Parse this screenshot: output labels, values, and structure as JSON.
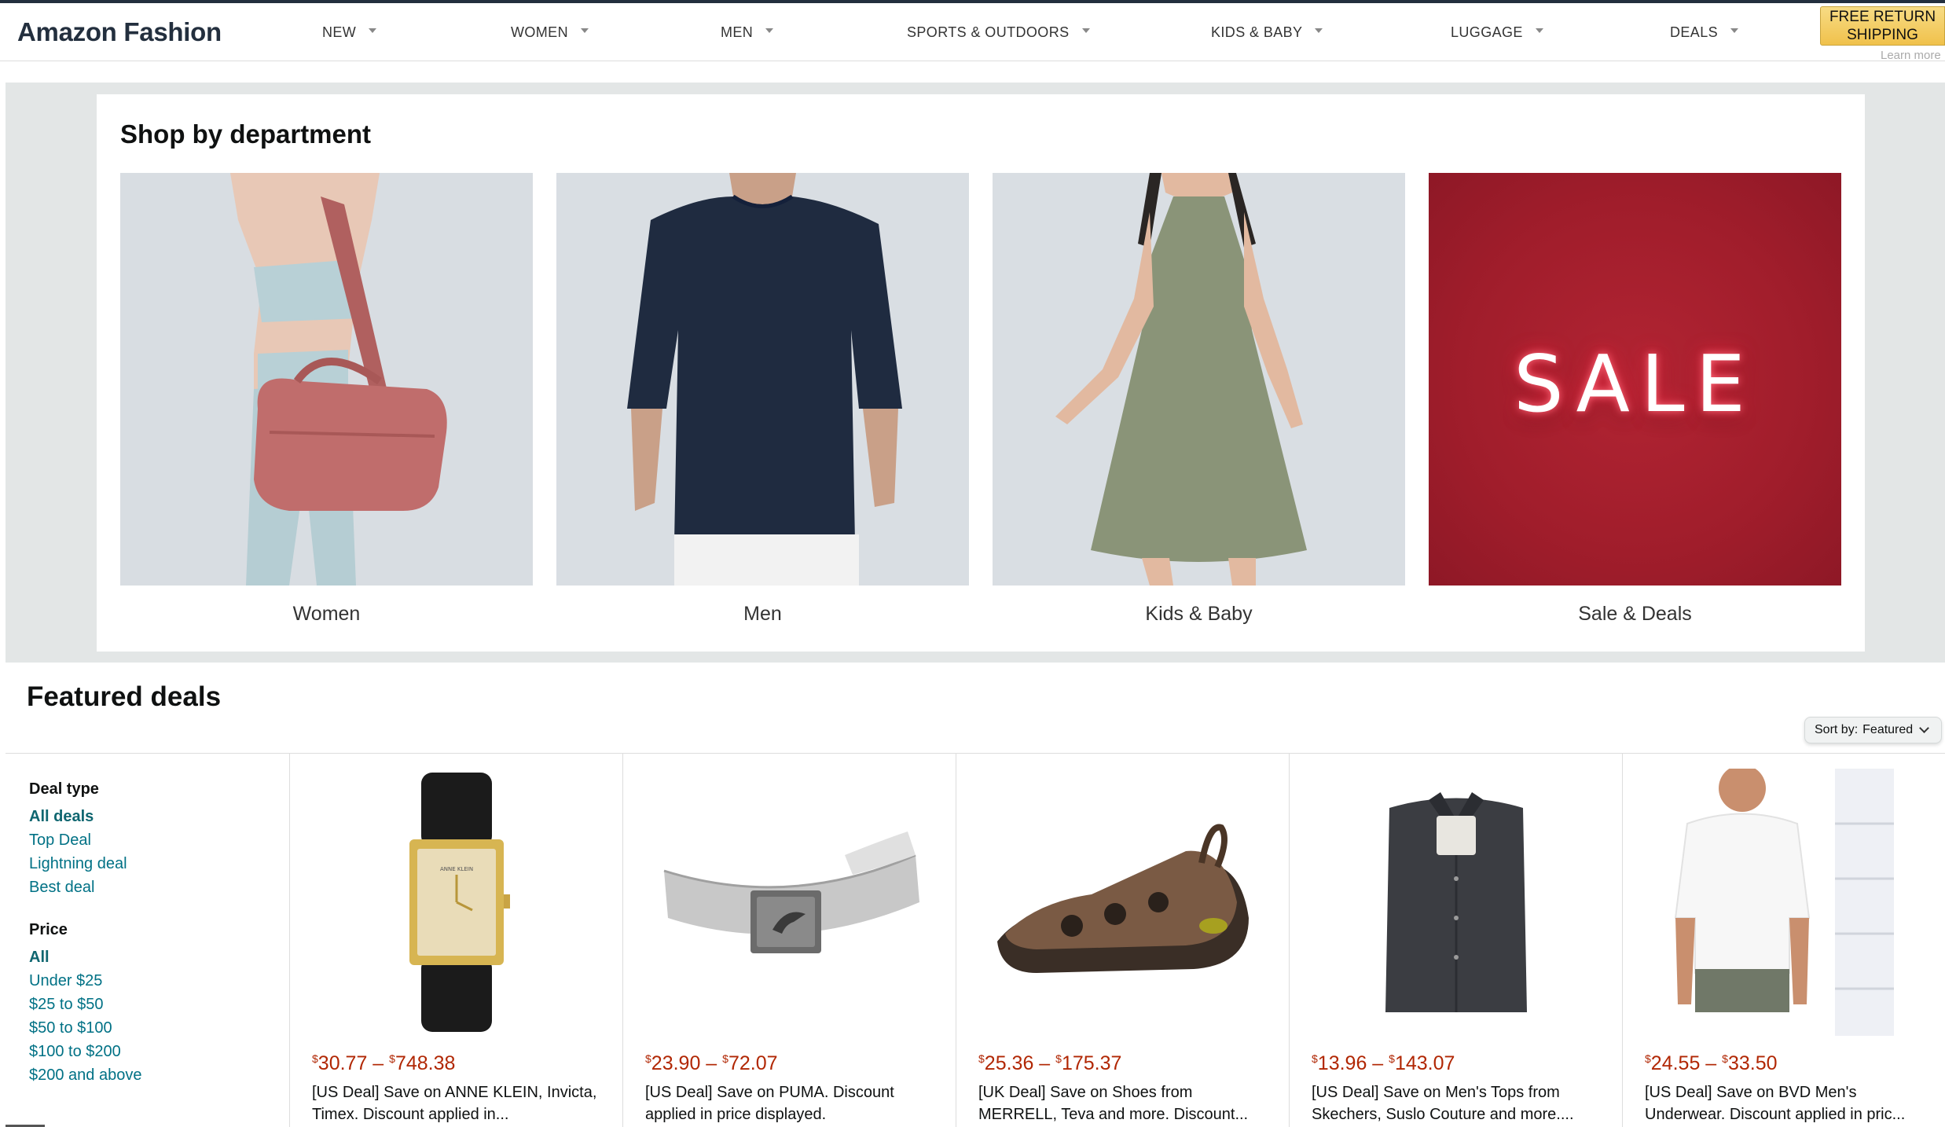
{
  "header": {
    "brand": "Amazon Fashion",
    "nav": [
      "NEW",
      "WOMEN",
      "MEN",
      "SPORTS & OUTDOORS",
      "KIDS & BABY",
      "LUGGAGE",
      "DEALS"
    ],
    "free_return_line1": "FREE RETURN",
    "free_return_line2": "SHIPPING",
    "learn_more": "Learn more"
  },
  "departments": {
    "title": "Shop by department",
    "tiles": [
      {
        "label": "Women"
      },
      {
        "label": "Men"
      },
      {
        "label": "Kids & Baby"
      },
      {
        "label": "Sale & Deals",
        "image_text": "SALE"
      }
    ]
  },
  "featured": {
    "title": "Featured deals",
    "sort_label": "Sort by:",
    "sort_value": "Featured",
    "filters": {
      "deal_type_heading": "Deal type",
      "deal_types": [
        "All deals",
        "Top Deal",
        "Lightning deal",
        "Best deal"
      ],
      "price_heading": "Price",
      "prices": [
        "All",
        "Under $25",
        "$25 to $50",
        "$50 to $100",
        "$100 to $200",
        "$200 and above"
      ]
    },
    "deals": [
      {
        "price_low": "30.77",
        "price_high": "748.38",
        "desc": "[US Deal] Save on ANNE KLEIN, Invicta, Timex. Discount applied in...",
        "icon": "watch-icon"
      },
      {
        "price_low": "23.90",
        "price_high": "72.07",
        "desc": "[US Deal] Save on PUMA. Discount applied in price displayed.",
        "icon": "belt-icon"
      },
      {
        "price_low": "25.36",
        "price_high": "175.37",
        "desc": "[UK Deal] Save on Shoes from MERRELL, Teva and more. Discount...",
        "icon": "sandal-icon"
      },
      {
        "price_low": "13.96",
        "price_high": "143.07",
        "desc": "[US Deal] Save on Men's Tops from Skechers, Suslo Couture and more....",
        "icon": "shirt-icon"
      },
      {
        "price_low": "24.55",
        "price_high": "33.50",
        "desc": "[US Deal] Save on BVD Men's Underwear. Discount applied in pric...",
        "icon": "tshirt-icon"
      }
    ]
  },
  "colors": {
    "price": "#b12704",
    "link": "#007185",
    "nav_dark": "#232f3e",
    "sale_red": "#a01d2b"
  }
}
